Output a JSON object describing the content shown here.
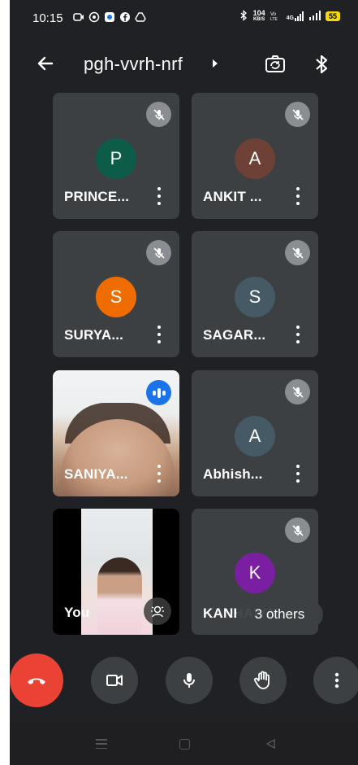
{
  "status_bar": {
    "time": "10:15",
    "net_speed": "104",
    "net_speed_unit": "KB/S",
    "network": "4G",
    "battery": "55"
  },
  "header": {
    "meeting_code": "pgh-vvrh-nrf"
  },
  "participants": [
    {
      "name": "PRINCE...",
      "initial": "P",
      "avatar_color": "#0d5c4a",
      "muted": true
    },
    {
      "name": "ANKIT ...",
      "initial": "A",
      "avatar_color": "#6d4135",
      "muted": true
    },
    {
      "name": "SURYA...",
      "initial": "S",
      "avatar_color": "#ef6c00",
      "muted": true
    },
    {
      "name": "SAGAR...",
      "initial": "S",
      "avatar_color": "#455a64",
      "muted": true
    },
    {
      "name": "SANIYA...",
      "video": true,
      "speaking": true
    },
    {
      "name": "Abhish...",
      "initial": "A",
      "avatar_color": "#455a64",
      "muted": true
    },
    {
      "name": "You",
      "self": true
    },
    {
      "name": "KANHAIYA...",
      "initial": "K",
      "avatar_color": "#7b1fa2",
      "muted": true
    }
  ],
  "others_label": "3 others",
  "controls": {
    "end_call": "end-call",
    "camera": "camera",
    "mic": "microphone",
    "raise_hand": "raise-hand",
    "more": "more"
  },
  "colors": {
    "background": "#202124",
    "tile": "#3c4043",
    "end_call": "#ea4335",
    "speaking": "#1a73e8"
  }
}
